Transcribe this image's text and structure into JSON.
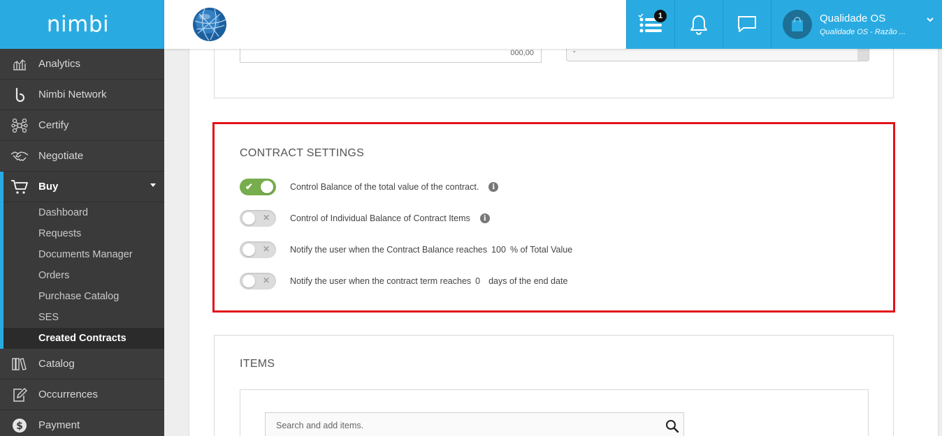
{
  "brand": {
    "logo_text": "nimbi",
    "accent": "#29abe2",
    "highlight": "#e3121b",
    "toggle_on": "#77ad4c"
  },
  "sidebar": {
    "items": [
      {
        "label": "Analytics",
        "icon": "analytics-chart-icon"
      },
      {
        "label": "Nimbi Network",
        "icon": "nimbi-b-icon"
      },
      {
        "label": "Certify",
        "icon": "network-nodes-icon"
      },
      {
        "label": "Negotiate",
        "icon": "handshake-icon"
      },
      {
        "label": "Buy",
        "icon": "cart-icon",
        "expanded": true
      }
    ],
    "buy_subitems": [
      "Dashboard",
      "Requests",
      "Documents Manager",
      "Orders",
      "Purchase Catalog",
      "SES",
      "Created Contracts"
    ],
    "selected_subitem": "Created Contracts",
    "bottom_items": [
      {
        "label": "Catalog",
        "icon": "books-icon"
      },
      {
        "label": "Occurrences",
        "icon": "edit-document-icon"
      },
      {
        "label": "Payment",
        "icon": "dollar-coin-icon"
      }
    ]
  },
  "topbar": {
    "tasks_badge": "1",
    "user_name": "Qualidade OS",
    "user_company": "Qualidade OS - Razão ..."
  },
  "top_card": {
    "amount_value": "000,00",
    "select_value": "-"
  },
  "contract_settings": {
    "title": "CONTRACT SETTINGS",
    "rows": [
      {
        "label": "Control Balance of the total value of the contract.",
        "enabled": true,
        "has_info": true
      },
      {
        "label": "Control of Individual Balance of Contract Items",
        "enabled": false,
        "has_info": true
      },
      {
        "label_before": "Notify the user when the Contract Balance reaches",
        "value": "100",
        "label_after": "% of Total Value",
        "enabled": false
      },
      {
        "label_before": "Notify the user when the contract term reaches",
        "value": "0",
        "label_after": "days of the end date",
        "enabled": false
      }
    ]
  },
  "items": {
    "title": "ITEMS",
    "search_placeholder": "Search and add items."
  }
}
